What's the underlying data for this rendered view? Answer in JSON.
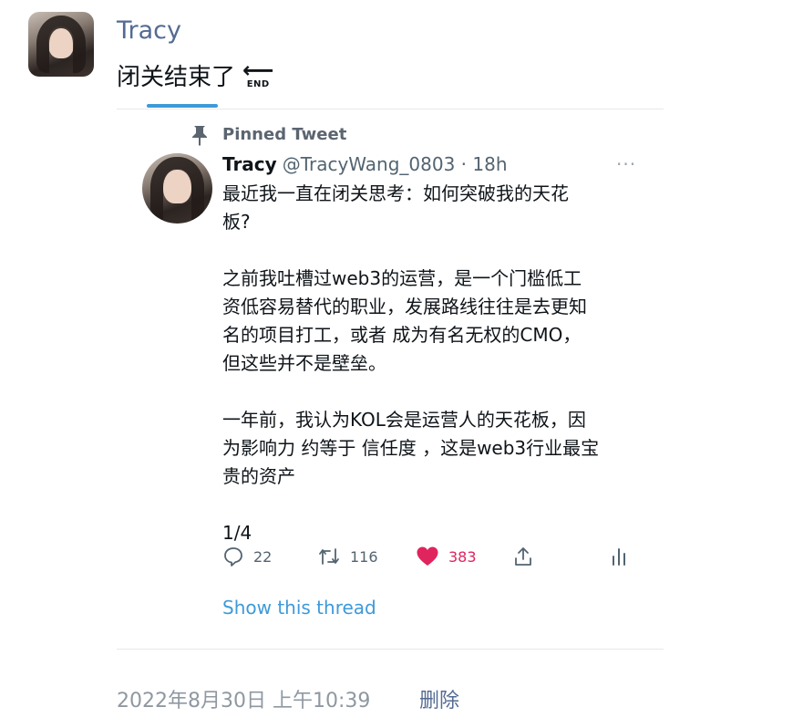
{
  "tweet": {
    "author_name": "Tracy",
    "text": "闭关结束了",
    "end_icon_label": "END",
    "timestamp": "2022年8月30日 上午10:39",
    "delete_label": "删除"
  },
  "pinned_tweet": {
    "pinned_label": "Pinned Tweet",
    "name": "Tracy",
    "handle": "@TracyWang_0803",
    "separator": "·",
    "time_ago": "18h",
    "more_icon": "···",
    "paragraphs": [
      [
        "最近我一直在闭关思考：如何突破我的天花",
        "板?"
      ],
      [
        "之前我吐槽过web3的运营，是一个门槛低工",
        "资低容易替代的职业，发展路线往往是去更知",
        "名的项目打工，或者 成为有名无权的CMO，",
        "但这些并不是壁垒。"
      ],
      [
        "一年前，我认为KOL会是运营人的天花板，因",
        "为影响力 约等于 信任度 ，这是web3行业最宝",
        "贵的资产"
      ],
      [
        "1/4"
      ]
    ],
    "stats": {
      "replies": "22",
      "retweets": "116",
      "likes": "383"
    },
    "show_thread_label": "Show this thread"
  },
  "icons": {
    "pin": "pin-icon",
    "reply": "reply-icon",
    "retweet": "retweet-icon",
    "like": "heart-icon",
    "share": "share-icon",
    "analytics": "analytics-icon",
    "end": "end-arrow-icon"
  },
  "colors": {
    "link_blue": "#3d9ad9",
    "name_blue": "#536b92",
    "like_pink": "#e0245e",
    "muted": "#536471"
  }
}
